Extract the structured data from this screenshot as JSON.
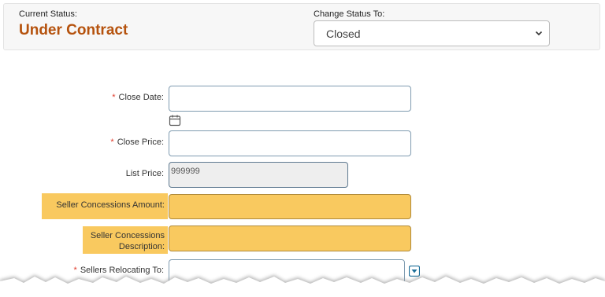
{
  "status": {
    "current_label": "Current Status:",
    "current_value": "Under Contract",
    "change_label": "Change Status To:",
    "change_value": "Closed"
  },
  "form": {
    "close_date_label": "Close Date:",
    "close_price_label": "Close Price:",
    "list_price_label": "List Price:",
    "list_price_value": "999999",
    "seller_concessions_amount_label": "Seller Concessions Amount:",
    "seller_concessions_desc_label_1": "Seller Concessions",
    "seller_concessions_desc_label_2": "Description:",
    "sellers_relocating_label": "Sellers Relocating To:",
    "required_marker": "*"
  },
  "icons": {
    "calendar": "calendar-icon",
    "dropdown": "dropdown-arrow-icon",
    "chevron": "chevron-down-icon"
  },
  "colors": {
    "status_value": "#b5520d",
    "highlight": "#f9c95f",
    "required": "#e03a2a",
    "dropdown_button": "#1e6f99"
  }
}
